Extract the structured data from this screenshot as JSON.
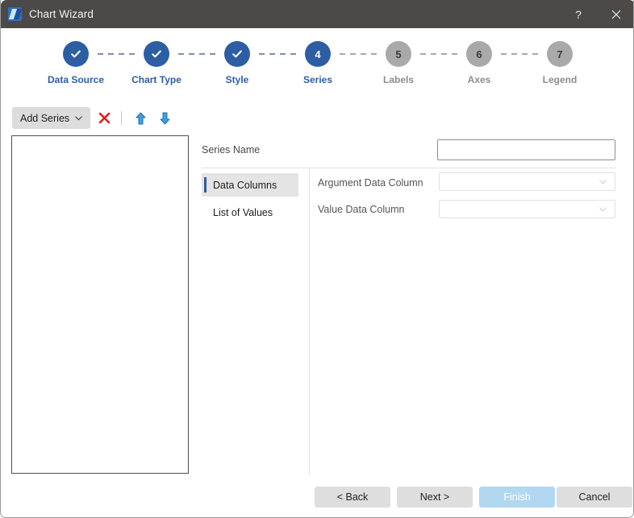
{
  "window": {
    "title": "Chart Wizard",
    "icon": "chart-wizard-app-icon",
    "help_label": "?",
    "close_label": "×"
  },
  "stepper": {
    "steps": [
      {
        "number": "1",
        "label": "Data Source",
        "state": "done",
        "glyph": "check-icon"
      },
      {
        "number": "2",
        "label": "Chart Type",
        "state": "done",
        "glyph": "check-icon"
      },
      {
        "number": "3",
        "label": "Style",
        "state": "done",
        "glyph": "check-icon"
      },
      {
        "number": "4",
        "label": "Series",
        "state": "active",
        "glyph": "4"
      },
      {
        "number": "5",
        "label": "Labels",
        "state": "todo",
        "glyph": "5"
      },
      {
        "number": "6",
        "label": "Axes",
        "state": "todo",
        "glyph": "6"
      },
      {
        "number": "7",
        "label": "Legend",
        "state": "todo",
        "glyph": "7"
      }
    ],
    "active_color": "#2d5ea4",
    "inactive_color": "#a9a9a9"
  },
  "toolbar": {
    "add_series_label": "Add Series",
    "add_series_caret": "chevron-down-icon",
    "delete_icon": "delete-x-icon",
    "move_up_icon": "arrow-up-icon",
    "move_down_icon": "arrow-down-icon",
    "delete_color": "#e02020",
    "arrow_color": "#2f8fd8"
  },
  "series_list": {
    "items": [],
    "empty": true
  },
  "form": {
    "series_name_label": "Series Name",
    "series_name_value": "",
    "series_name_placeholder": "",
    "subtabs": [
      {
        "label": "Data Columns",
        "selected": true
      },
      {
        "label": "List of Values",
        "selected": false
      }
    ],
    "fields": [
      {
        "label": "Argument Data Column",
        "value": "",
        "type": "dropdown"
      },
      {
        "label": "Value Data Column",
        "value": "",
        "type": "dropdown"
      }
    ]
  },
  "footer": {
    "back_label": "< Back",
    "next_label": "Next >",
    "finish_label": "Finish",
    "cancel_label": "Cancel",
    "finish_color": "#b2d7f0"
  }
}
